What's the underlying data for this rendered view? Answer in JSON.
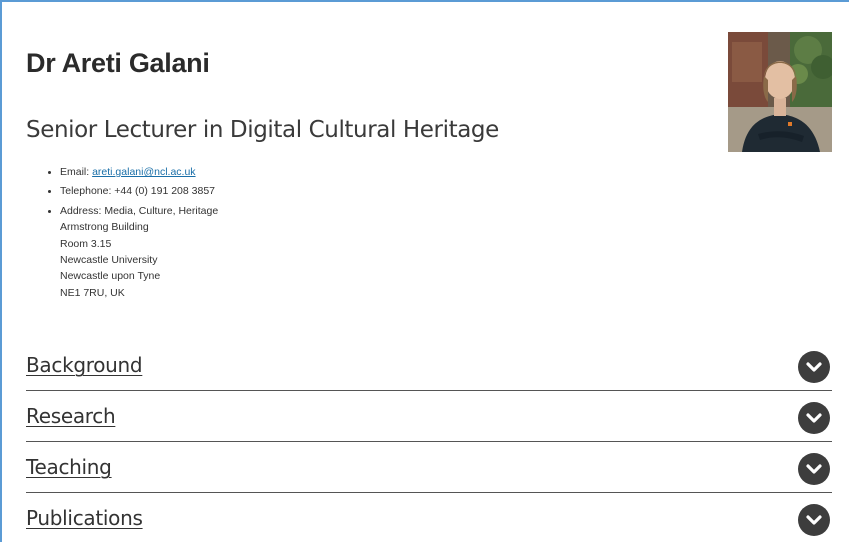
{
  "profile": {
    "name": "Dr Areti Galani",
    "title": "Senior Lecturer in Digital Cultural Heritage"
  },
  "contact": {
    "email_label": "Email: ",
    "email_value": "areti.galani@ncl.ac.uk",
    "telephone": "Telephone: +44 (0) 191 208 3857",
    "address_lines": [
      "Address: Media, Culture, Heritage",
      "Armstrong Building",
      "Room 3.15",
      "Newcastle University",
      "Newcastle upon Tyne",
      "NE1 7RU, UK"
    ]
  },
  "accordion": [
    {
      "label": "Background",
      "icon": "chevron-down-icon"
    },
    {
      "label": "Research",
      "icon": "chevron-down-icon"
    },
    {
      "label": "Teaching",
      "icon": "chevron-down-icon"
    },
    {
      "label": "Publications",
      "icon": "chevron-down-icon"
    }
  ],
  "colors": {
    "link": "#1a6fa8",
    "toggle_bg": "#3d3d3d",
    "frame_border": "#5b9bd5"
  }
}
